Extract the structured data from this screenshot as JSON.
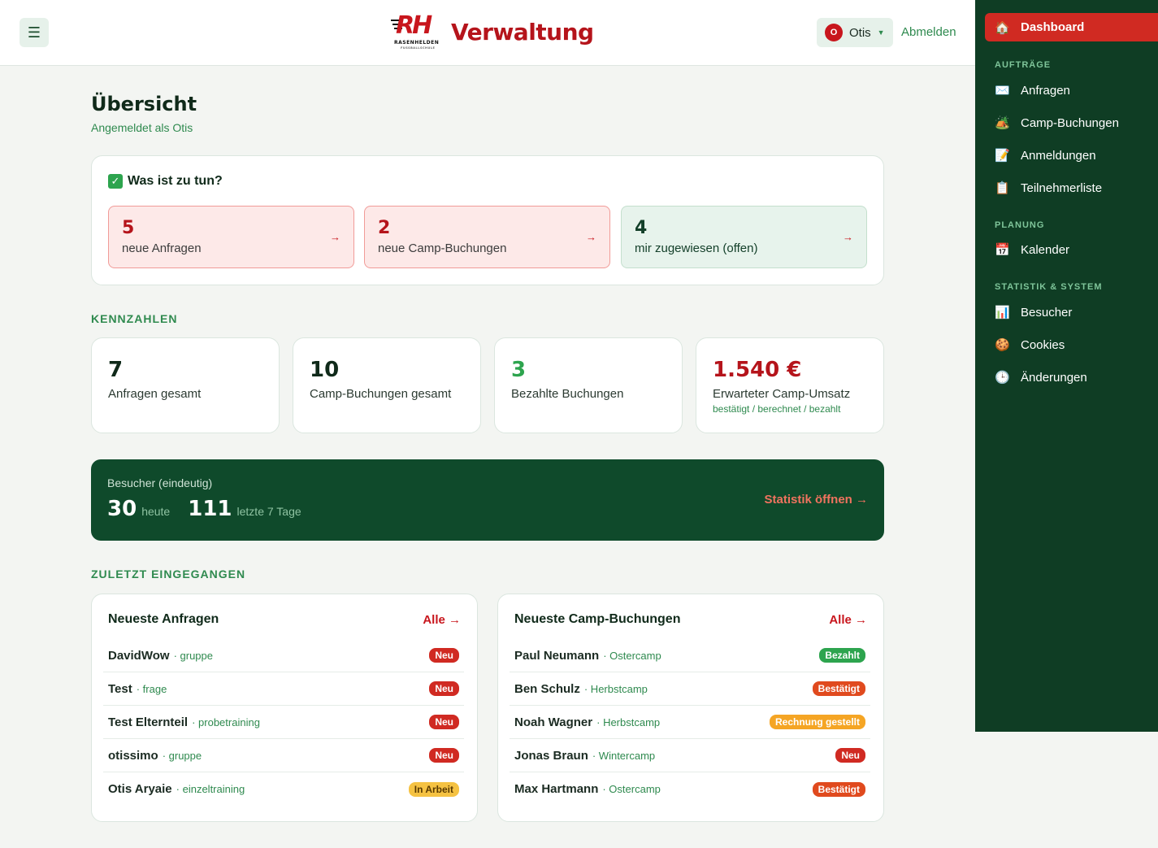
{
  "header": {
    "menu_icon": "☰",
    "logo_letters": "RH",
    "logo_sub": "RASENHELDEN",
    "logo_sub2": "FUSSBALLSCHULE",
    "title": "Verwaltung",
    "user_initial": "O",
    "user_name": "Otis",
    "logout_label": "Abmelden"
  },
  "sidebar": {
    "active": {
      "icon": "🏠",
      "label": "Dashboard"
    },
    "section_orders": "AUFTRÄGE",
    "orders": [
      {
        "icon": "✉️",
        "label": "Anfragen"
      },
      {
        "icon": "🏕️",
        "label": "Camp-Buchungen"
      },
      {
        "icon": "📝",
        "label": "Anmeldungen"
      },
      {
        "icon": "📋",
        "label": "Teilnehmerliste"
      }
    ],
    "section_planning": "PLANUNG",
    "planning": [
      {
        "icon": "📅",
        "label": "Kalender"
      }
    ],
    "section_stats": "STATISTIK & SYSTEM",
    "stats": [
      {
        "icon": "📊",
        "label": "Besucher"
      },
      {
        "icon": "🍪",
        "label": "Cookies"
      },
      {
        "icon": "🕒",
        "label": "Änderungen"
      }
    ]
  },
  "main": {
    "title": "Übersicht",
    "subtitle": "Angemeldet als Otis",
    "todo": {
      "title": "Was ist zu tun?",
      "check": "✓",
      "items": [
        {
          "num": "5",
          "label": "neue Anfragen",
          "arrow": "→"
        },
        {
          "num": "2",
          "label": "neue Camp-Buchungen",
          "arrow": "→"
        },
        {
          "num": "4",
          "label": "mir zugewiesen (offen)",
          "arrow": "→"
        }
      ]
    },
    "kpi_head": "KENNZAHLEN",
    "kpis": [
      {
        "num": "7",
        "label": "Anfragen gesamt"
      },
      {
        "num": "10",
        "label": "Camp-Buchungen gesamt"
      },
      {
        "num": "3",
        "label": "Bezahlte Buchungen"
      },
      {
        "num": "1.540 €",
        "label": "Erwarteter Camp-Umsatz",
        "sub": "bestätigt / berechnet / bezahlt"
      }
    ],
    "visitors": {
      "title": "Besucher (eindeutig)",
      "today_num": "30",
      "today_label": "heute",
      "week_num": "111",
      "week_label": "letzte 7 Tage",
      "link": "Statistik öffnen →"
    },
    "recent_head": "ZULETZT EINGEGANGEN",
    "requests": {
      "title": "Neueste Anfragen",
      "all": "Alle →",
      "rows": [
        {
          "name": "DavidWow",
          "type": "· gruppe",
          "badge": "Neu"
        },
        {
          "name": "Test",
          "type": "· frage",
          "badge": "Neu"
        },
        {
          "name": "Test Elternteil",
          "type": "· probetraining",
          "badge": "Neu"
        },
        {
          "name": "otissimo",
          "type": "· gruppe",
          "badge": "Neu"
        },
        {
          "name": "Otis Aryaie",
          "type": "· einzeltraining",
          "badge": "In Arbeit"
        }
      ]
    },
    "bookings": {
      "title": "Neueste Camp-Buchungen",
      "all": "Alle →",
      "rows": [
        {
          "name": "Paul Neumann",
          "type": "· Ostercamp",
          "badge": "Bezahlt"
        },
        {
          "name": "Ben Schulz",
          "type": "· Herbstcamp",
          "badge": "Bestätigt"
        },
        {
          "name": "Noah Wagner",
          "type": "· Herbstcamp",
          "badge": "Rechnung gestellt"
        },
        {
          "name": "Jonas Braun",
          "type": "· Wintercamp",
          "badge": "Neu"
        },
        {
          "name": "Max Hartmann",
          "type": "· Ostercamp",
          "badge": "Bestätigt"
        }
      ]
    }
  },
  "colors": {
    "brand_red": "#b5141b",
    "sidebar_green": "#0f3d24",
    "visitor_green": "#0f4a2b",
    "accent_green": "#2f8a4f"
  }
}
